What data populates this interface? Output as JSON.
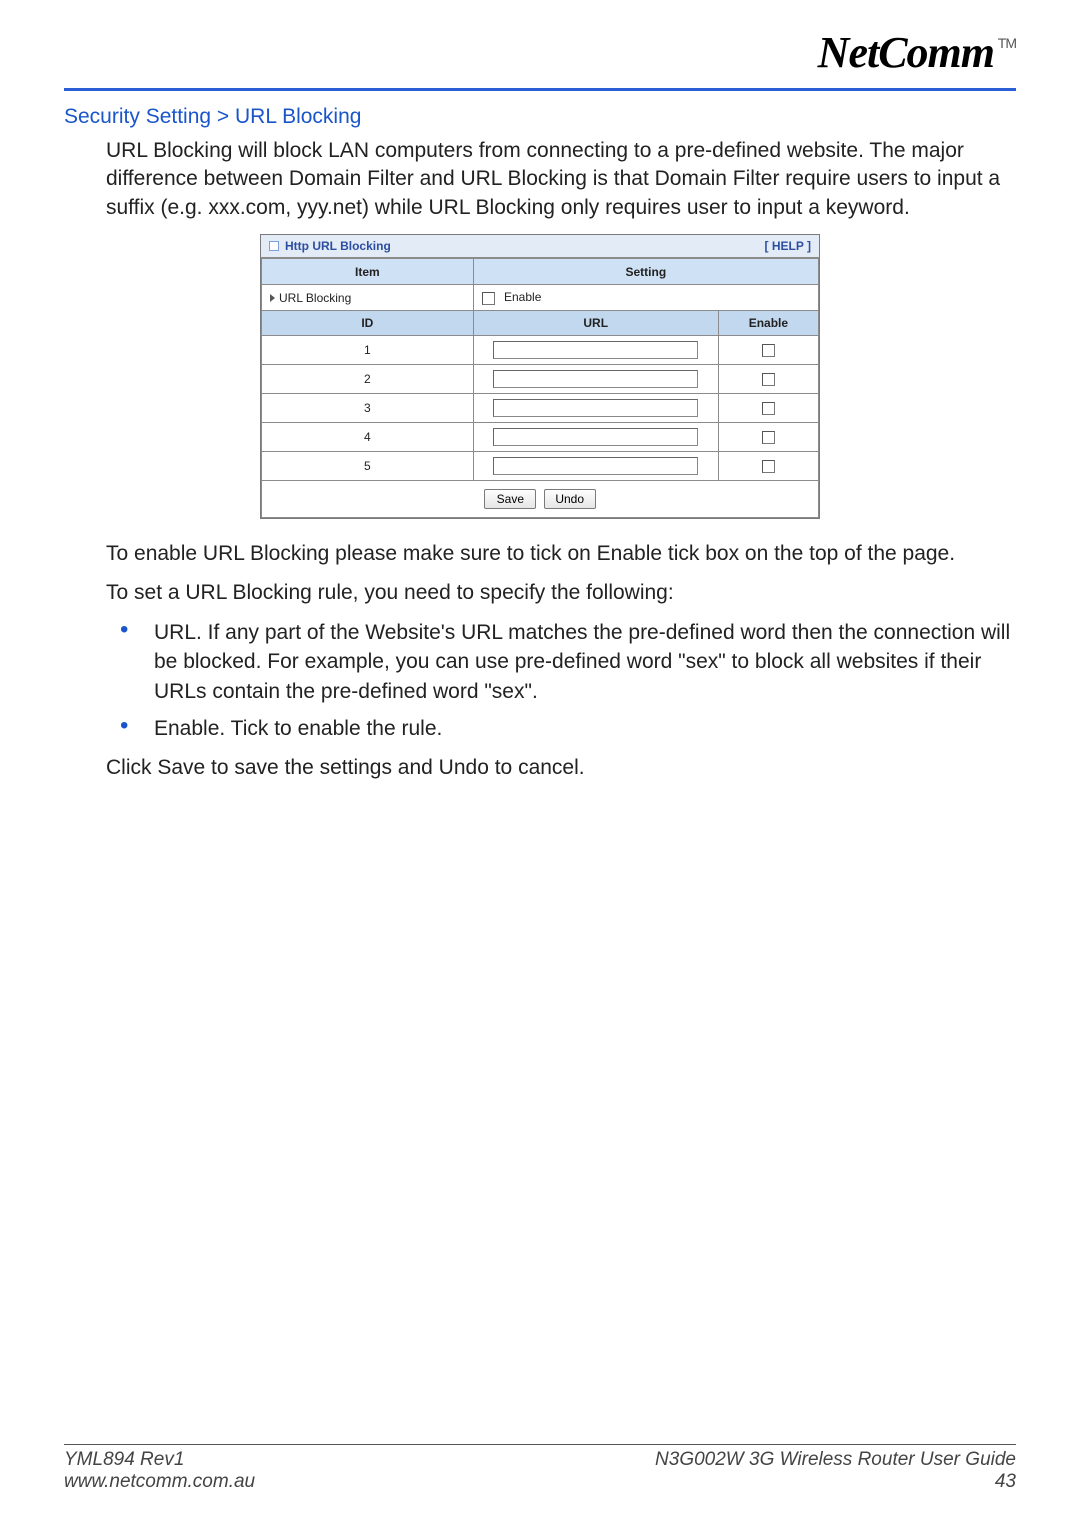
{
  "brand": {
    "name": "NetComm",
    "tm": "TM"
  },
  "breadcrumb": "Security Setting > URL Blocking",
  "intro": "URL Blocking will block LAN computers from connecting to a pre-defined website. The major difference between Domain Filter and URL Blocking is that Domain Filter require users to input a suffix (e.g. xxx.com, yyy.net) while URL Blocking only requires user to input a keyword.",
  "panel": {
    "title": "Http URL Blocking",
    "help": "[ HELP ]",
    "cols": {
      "item": "Item",
      "setting": "Setting"
    },
    "enable_row": {
      "label": "URL Blocking",
      "checkbox_label": "Enable"
    },
    "sub_cols": {
      "id": "ID",
      "url": "URL",
      "enable": "Enable"
    },
    "rows": [
      {
        "id": "1",
        "url": "",
        "enable": false
      },
      {
        "id": "2",
        "url": "",
        "enable": false
      },
      {
        "id": "3",
        "url": "",
        "enable": false
      },
      {
        "id": "4",
        "url": "",
        "enable": false
      },
      {
        "id": "5",
        "url": "",
        "enable": false
      }
    ],
    "buttons": {
      "save": "Save",
      "undo": "Undo"
    }
  },
  "after_panel": {
    "p1": "To enable URL Blocking please make sure to tick on Enable tick box on the top of the page.",
    "p2": "To set a URL Blocking rule, you need to specify the following:",
    "li1": "URL. If any part of the Website's URL matches the pre-defined word then the connection will be blocked. For example, you can use pre-defined word \"sex\" to block all websites if their URLs contain the pre-defined word \"sex\".",
    "li2": "Enable. Tick to enable the rule.",
    "p3": "Click Save to save the settings and Undo to cancel."
  },
  "footer": {
    "left1": "YML894 Rev1",
    "left2": "www.netcomm.com.au",
    "right1": "N3G002W 3G Wireless Router User Guide",
    "right2": "43"
  }
}
